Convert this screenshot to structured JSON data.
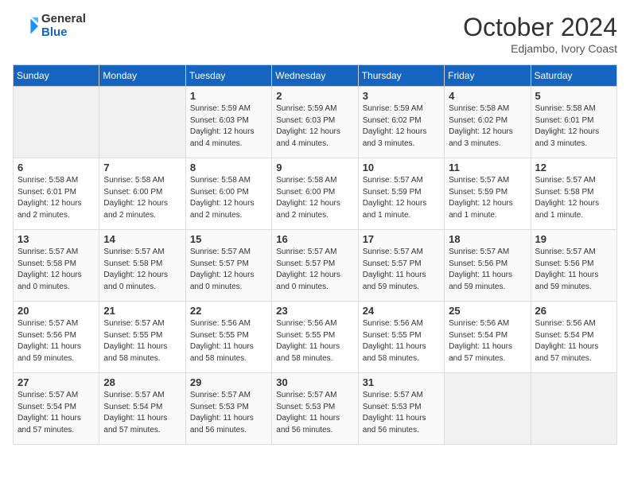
{
  "logo": {
    "general": "General",
    "blue": "Blue"
  },
  "title": {
    "month": "October 2024",
    "location": "Edjambo, Ivory Coast"
  },
  "weekdays": [
    "Sunday",
    "Monday",
    "Tuesday",
    "Wednesday",
    "Thursday",
    "Friday",
    "Saturday"
  ],
  "weeks": [
    [
      {
        "day": "",
        "empty": true
      },
      {
        "day": "",
        "empty": true
      },
      {
        "day": "1",
        "sunrise": "5:59 AM",
        "sunset": "6:03 PM",
        "daylight": "12 hours and 4 minutes."
      },
      {
        "day": "2",
        "sunrise": "5:59 AM",
        "sunset": "6:03 PM",
        "daylight": "12 hours and 4 minutes."
      },
      {
        "day": "3",
        "sunrise": "5:59 AM",
        "sunset": "6:02 PM",
        "daylight": "12 hours and 3 minutes."
      },
      {
        "day": "4",
        "sunrise": "5:58 AM",
        "sunset": "6:02 PM",
        "daylight": "12 hours and 3 minutes."
      },
      {
        "day": "5",
        "sunrise": "5:58 AM",
        "sunset": "6:01 PM",
        "daylight": "12 hours and 3 minutes."
      }
    ],
    [
      {
        "day": "6",
        "sunrise": "5:58 AM",
        "sunset": "6:01 PM",
        "daylight": "12 hours and 2 minutes."
      },
      {
        "day": "7",
        "sunrise": "5:58 AM",
        "sunset": "6:00 PM",
        "daylight": "12 hours and 2 minutes."
      },
      {
        "day": "8",
        "sunrise": "5:58 AM",
        "sunset": "6:00 PM",
        "daylight": "12 hours and 2 minutes."
      },
      {
        "day": "9",
        "sunrise": "5:58 AM",
        "sunset": "6:00 PM",
        "daylight": "12 hours and 2 minutes."
      },
      {
        "day": "10",
        "sunrise": "5:57 AM",
        "sunset": "5:59 PM",
        "daylight": "12 hours and 1 minute."
      },
      {
        "day": "11",
        "sunrise": "5:57 AM",
        "sunset": "5:59 PM",
        "daylight": "12 hours and 1 minute."
      },
      {
        "day": "12",
        "sunrise": "5:57 AM",
        "sunset": "5:58 PM",
        "daylight": "12 hours and 1 minute."
      }
    ],
    [
      {
        "day": "13",
        "sunrise": "5:57 AM",
        "sunset": "5:58 PM",
        "daylight": "12 hours and 0 minutes."
      },
      {
        "day": "14",
        "sunrise": "5:57 AM",
        "sunset": "5:58 PM",
        "daylight": "12 hours and 0 minutes."
      },
      {
        "day": "15",
        "sunrise": "5:57 AM",
        "sunset": "5:57 PM",
        "daylight": "12 hours and 0 minutes."
      },
      {
        "day": "16",
        "sunrise": "5:57 AM",
        "sunset": "5:57 PM",
        "daylight": "12 hours and 0 minutes."
      },
      {
        "day": "17",
        "sunrise": "5:57 AM",
        "sunset": "5:57 PM",
        "daylight": "11 hours and 59 minutes."
      },
      {
        "day": "18",
        "sunrise": "5:57 AM",
        "sunset": "5:56 PM",
        "daylight": "11 hours and 59 minutes."
      },
      {
        "day": "19",
        "sunrise": "5:57 AM",
        "sunset": "5:56 PM",
        "daylight": "11 hours and 59 minutes."
      }
    ],
    [
      {
        "day": "20",
        "sunrise": "5:57 AM",
        "sunset": "5:56 PM",
        "daylight": "11 hours and 59 minutes."
      },
      {
        "day": "21",
        "sunrise": "5:57 AM",
        "sunset": "5:55 PM",
        "daylight": "11 hours and 58 minutes."
      },
      {
        "day": "22",
        "sunrise": "5:56 AM",
        "sunset": "5:55 PM",
        "daylight": "11 hours and 58 minutes."
      },
      {
        "day": "23",
        "sunrise": "5:56 AM",
        "sunset": "5:55 PM",
        "daylight": "11 hours and 58 minutes."
      },
      {
        "day": "24",
        "sunrise": "5:56 AM",
        "sunset": "5:55 PM",
        "daylight": "11 hours and 58 minutes."
      },
      {
        "day": "25",
        "sunrise": "5:56 AM",
        "sunset": "5:54 PM",
        "daylight": "11 hours and 57 minutes."
      },
      {
        "day": "26",
        "sunrise": "5:56 AM",
        "sunset": "5:54 PM",
        "daylight": "11 hours and 57 minutes."
      }
    ],
    [
      {
        "day": "27",
        "sunrise": "5:57 AM",
        "sunset": "5:54 PM",
        "daylight": "11 hours and 57 minutes."
      },
      {
        "day": "28",
        "sunrise": "5:57 AM",
        "sunset": "5:54 PM",
        "daylight": "11 hours and 57 minutes."
      },
      {
        "day": "29",
        "sunrise": "5:57 AM",
        "sunset": "5:53 PM",
        "daylight": "11 hours and 56 minutes."
      },
      {
        "day": "30",
        "sunrise": "5:57 AM",
        "sunset": "5:53 PM",
        "daylight": "11 hours and 56 minutes."
      },
      {
        "day": "31",
        "sunrise": "5:57 AM",
        "sunset": "5:53 PM",
        "daylight": "11 hours and 56 minutes."
      },
      {
        "day": "",
        "empty": true
      },
      {
        "day": "",
        "empty": true
      }
    ]
  ],
  "labels": {
    "sunrise": "Sunrise:",
    "sunset": "Sunset:",
    "daylight": "Daylight:"
  }
}
